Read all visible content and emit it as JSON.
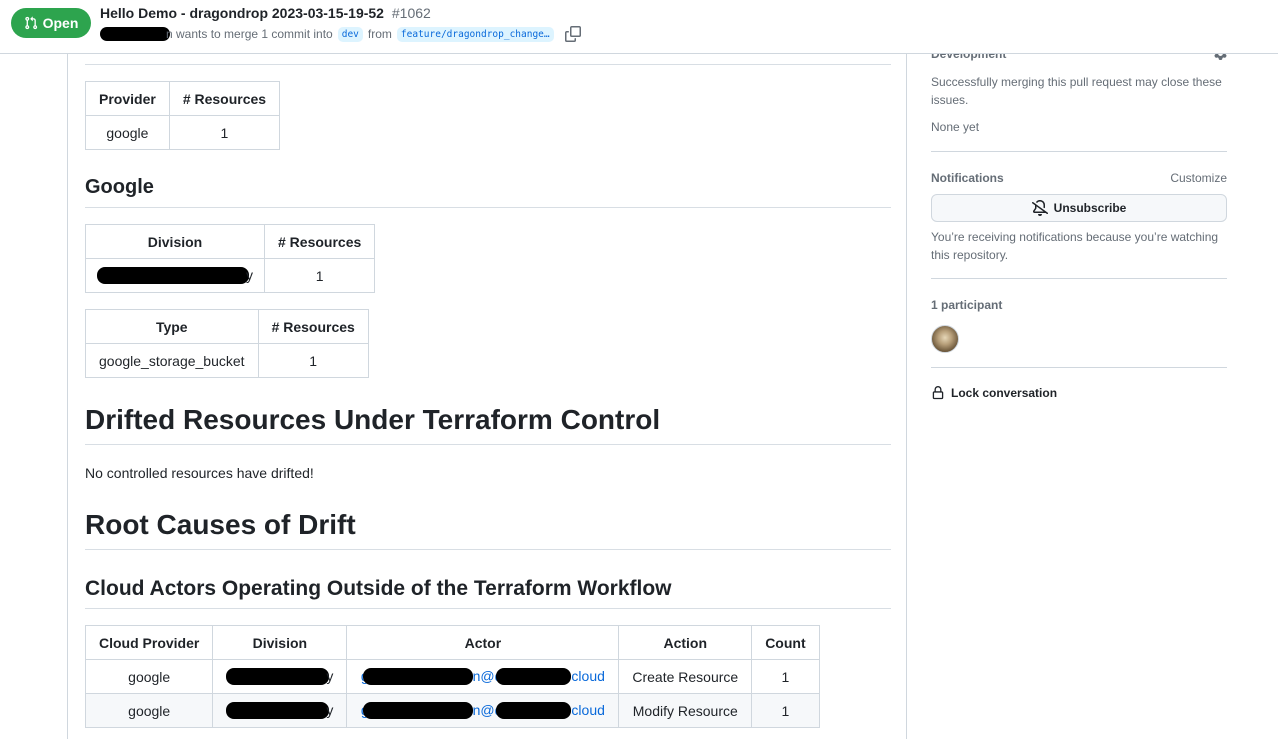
{
  "header": {
    "state": "Open",
    "title": "Hello Demo - dragondrop 2023-03-15-19-52",
    "number": "#1062",
    "meta_tail": "n wants to merge 1 commit into",
    "base_branch": "dev",
    "from_text": "from",
    "head_branch": "feature/dragondrop_change…"
  },
  "main": {
    "provider_table": {
      "headers": [
        "Provider",
        "# Resources"
      ],
      "rows": [
        [
          "google",
          "1"
        ]
      ]
    },
    "google_heading": "Google",
    "division_table": {
      "headers": [
        "Division",
        "# Resources"
      ],
      "division_visible_tail": "y",
      "count": "1"
    },
    "type_table": {
      "headers": [
        "Type",
        "# Resources"
      ],
      "rows": [
        [
          "google_storage_bucket",
          "1"
        ]
      ]
    },
    "drifted_heading": "Drifted Resources Under Terraform Control",
    "drifted_text": "No controlled resources have drifted!",
    "root_causes_heading": "Root Causes of Drift",
    "cloud_actors_heading": "Cloud Actors Operating Outside of the Terraform Workflow",
    "actors_table": {
      "headers": [
        "Cloud Provider",
        "Division",
        "Actor",
        "Action",
        "Count"
      ],
      "rows": [
        {
          "provider": "google",
          "division_tail": "y",
          "actor_start": "g",
          "actor_mid": "n@",
          "actor_pre": "d",
          "actor_end": "cloud",
          "action": "Create Resource",
          "count": "1"
        },
        {
          "provider": "google",
          "division_tail": "y",
          "actor_start": "g",
          "actor_mid": "n@",
          "actor_pre": "d",
          "actor_end": "cloud",
          "action": "Modify Resource",
          "count": "1"
        }
      ]
    }
  },
  "sidebar": {
    "development_heading": "Development",
    "development_text": "Successfully merging this pull request may close these issues.",
    "none_yet": "None yet",
    "notifications_heading": "Notifications",
    "customize": "Customize",
    "unsubscribe": "Unsubscribe",
    "notification_reason": "You’re receiving notifications because you’re watching this repository.",
    "participants": "1 participant",
    "lock": "Lock conversation"
  },
  "colors": {
    "open_green": "#2da44e",
    "link_blue": "#0969da",
    "branch_bg": "#ddf4ff",
    "border": "#d0d7de"
  }
}
